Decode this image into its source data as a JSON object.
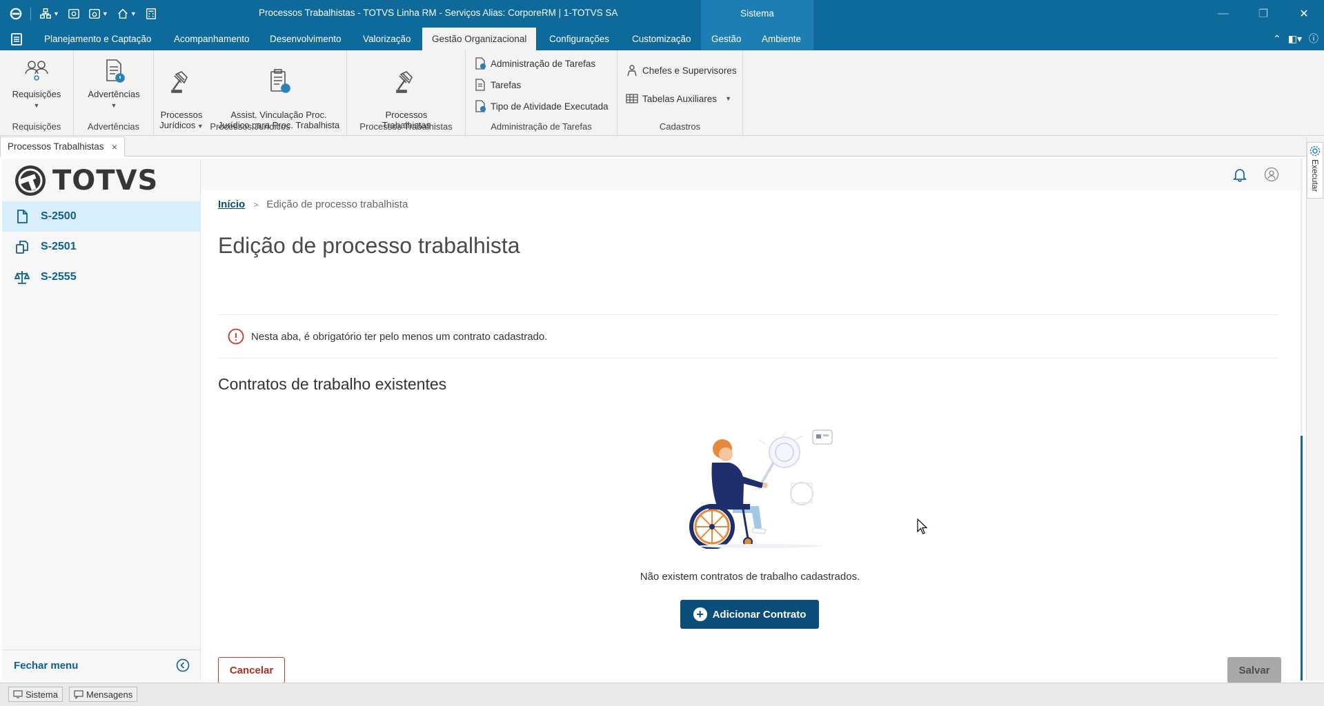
{
  "titlebar": {
    "title": "Processos Trabalhistas - TOTVS Linha RM - Serviços  Alias: CorporeRM | 1-TOTVS SA",
    "context_tab": "Sistema"
  },
  "menu": {
    "items": [
      {
        "label": "Planejamento e Captação"
      },
      {
        "label": "Acompanhamento"
      },
      {
        "label": "Desenvolvimento"
      },
      {
        "label": "Valorização"
      },
      {
        "label": "Gestão Organizacional"
      },
      {
        "label": "Configurações"
      },
      {
        "label": "Customização"
      },
      {
        "label": "Gestão"
      },
      {
        "label": "Ambiente"
      }
    ],
    "active": "Gestão Organizacional"
  },
  "ribbon": {
    "groups": [
      {
        "label": "Requisições",
        "buttons": [
          "Requisições"
        ]
      },
      {
        "label": "Advertências",
        "buttons": [
          "Advertências"
        ]
      },
      {
        "label": "Processos Jurídicos",
        "buttons": [
          "Processos\nJurídicos",
          "Assist. Vinculação Proc.\nJurídico para Proc. Trabalhista"
        ]
      },
      {
        "label": "Processos Trabalhistas",
        "buttons": [
          "Processos\nTrabalhistas"
        ]
      },
      {
        "label": "Administração de Tarefas",
        "buttons": [
          "Administração de Tarefas",
          "Tarefas",
          "Tipo de Atividade Executada"
        ]
      },
      {
        "label": "Cadastros",
        "buttons": [
          "Chefes e Supervisores",
          "Tabelas Auxiliares"
        ]
      }
    ]
  },
  "doc_tab": {
    "label": "Processos Trabalhistas",
    "close": "×"
  },
  "leftnav": {
    "logo_text": "TOTVS",
    "items": [
      {
        "label": "S-2500",
        "icon": "document-icon",
        "active": true
      },
      {
        "label": "S-2501",
        "icon": "copy-icon",
        "active": false
      },
      {
        "label": "S-2555",
        "icon": "scale-icon",
        "active": false
      }
    ],
    "footer": "Fechar menu"
  },
  "main": {
    "breadcrumb": {
      "home": "Início",
      "separator": ">",
      "current": "Edição de processo trabalhista"
    },
    "title": "Edição de processo trabalhista",
    "alert": "Nesta aba, é obrigatório ter pelo menos um contrato cadastrado.",
    "section_title": "Contratos de trabalho existentes",
    "empty_text": "Não existem contratos de trabalho cadastrados.",
    "add_button": "Adicionar Contrato",
    "cancel_button": "Cancelar",
    "save_button": "Salvar"
  },
  "sidepanel": {
    "label": "Executar"
  },
  "statusbar": {
    "items": [
      "Sistema",
      "Mensagens"
    ]
  },
  "colors": {
    "primary": "#0e6a9b",
    "accent_button": "#0c4e7a",
    "danger": "#c0392b",
    "nav_active_bg": "#d9eefc"
  }
}
